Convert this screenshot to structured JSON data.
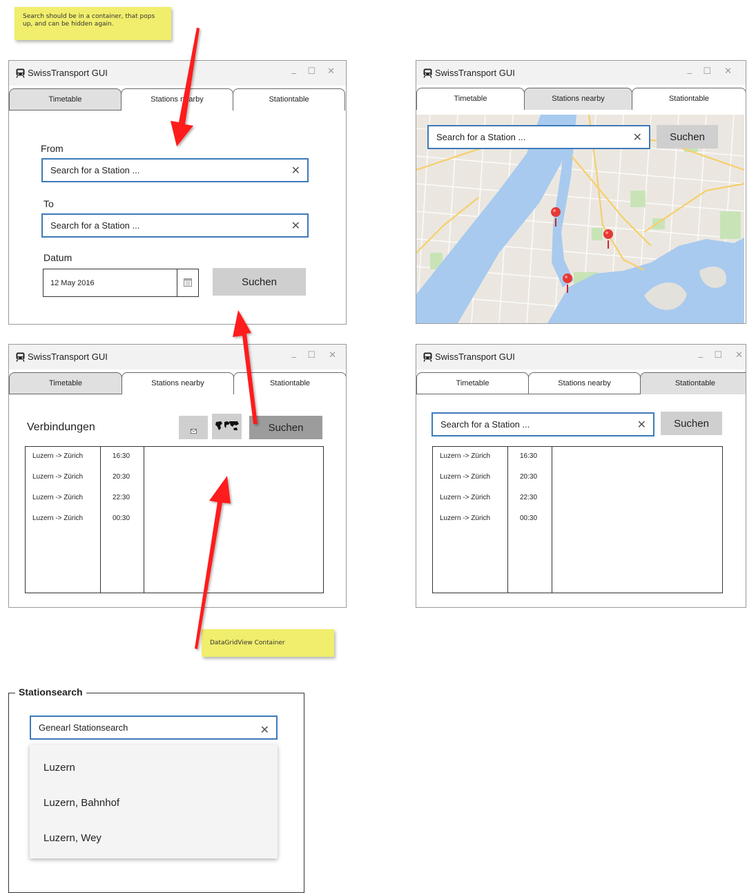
{
  "notes": {
    "search_container": "Search should be in a container, that pops up, and can be hidden again.",
    "datagrid": "DataGridView Container"
  },
  "app": {
    "title": "SwissTransport GUI"
  },
  "window_controls": {
    "minimize": "_",
    "maximize": "☐",
    "close": "✕"
  },
  "tabs": [
    "Timetable",
    "Stations nearby",
    "Stationtable"
  ],
  "window1": {
    "from_label": "From",
    "to_label": "To",
    "date_label": "Datum",
    "from_placeholder": "Search for a Station ...",
    "to_placeholder": "Search for a Station ...",
    "date_value": "12 May 2016",
    "search_button": "Suchen"
  },
  "window2": {
    "search_placeholder": "Search for a Station ...",
    "search_button": "Suchen"
  },
  "window3": {
    "heading": "Verbindungen",
    "search_button": "Suchen",
    "rows": [
      {
        "route": "Luzern -> Zürich",
        "time": "16:30"
      },
      {
        "route": "Luzern -> Zürich",
        "time": "20:30"
      },
      {
        "route": "Luzern -> Zürich",
        "time": "22:30"
      },
      {
        "route": "Luzern -> Zürich",
        "time": "00:30"
      }
    ]
  },
  "window4": {
    "search_placeholder": "Search for a Station ...",
    "search_button": "Suchen",
    "rows": [
      {
        "route": "Luzern -> Zürich",
        "time": "16:30"
      },
      {
        "route": "Luzern -> Zürich",
        "time": "20:30"
      },
      {
        "route": "Luzern -> Zürich",
        "time": "22:30"
      },
      {
        "route": "Luzern -> Zürich",
        "time": "00:30"
      }
    ]
  },
  "stationsearch": {
    "legend": "Stationsearch",
    "input_value": "Genearl Stationsearch",
    "suggestions": [
      "Luzern",
      "Luzern, Bahnhof",
      "Luzern, Wey"
    ]
  },
  "colors": {
    "accent_border": "#3d7ab8",
    "note_yellow": "#f0ee6c",
    "arrow_red": "#ff1a1a",
    "button_gray": "#cfcfcf",
    "tab_inactive": "#e0e0e0",
    "map_water": "#a5c8ee",
    "map_park": "#c5e3b5",
    "marker_red": "#e53935"
  }
}
